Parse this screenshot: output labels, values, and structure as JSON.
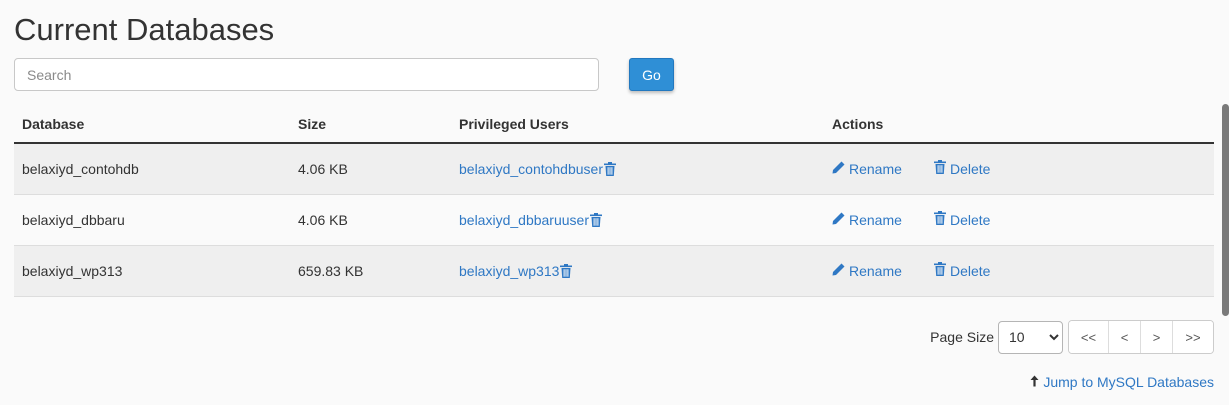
{
  "header": {
    "title": "Current Databases"
  },
  "search": {
    "placeholder": "Search",
    "go_label": "Go"
  },
  "table": {
    "columns": {
      "database": "Database",
      "size": "Size",
      "users": "Privileged Users",
      "actions": "Actions"
    },
    "rows": [
      {
        "database": "belaxiyd_contohdb",
        "size": "4.06 KB",
        "user": "belaxiyd_contohdbuser",
        "rename": "Rename",
        "delete": "Delete"
      },
      {
        "database": "belaxiyd_dbbaru",
        "size": "4.06 KB",
        "user": "belaxiyd_dbbaruuser",
        "rename": "Rename",
        "delete": "Delete"
      },
      {
        "database": "belaxiyd_wp313",
        "size": "659.83 KB",
        "user": "belaxiyd_wp313",
        "rename": "Rename",
        "delete": "Delete"
      }
    ]
  },
  "pagination": {
    "page_size_label": "Page Size",
    "page_size_value": "10",
    "first": "<<",
    "prev": "<",
    "next": ">",
    "last": ">>"
  },
  "footer": {
    "jump_link": "Jump to MySQL Databases"
  },
  "colors": {
    "accent": "#2f8fd6",
    "link": "#2f78c4"
  },
  "icons": {
    "rename": "pencil-icon",
    "delete": "trash-icon",
    "jump": "arrow-up-icon"
  }
}
